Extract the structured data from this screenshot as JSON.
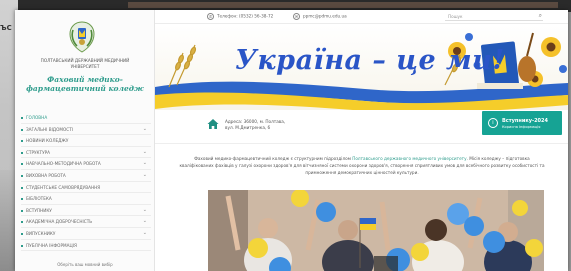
{
  "background": {
    "stray_text": "ЪС"
  },
  "sidebar": {
    "university_name": "Полтавський державний медичний університет",
    "college_name": "Фаховий медико-фармацевтичний коледж",
    "menu": [
      {
        "label": "Головна",
        "active": true,
        "has_submenu": false
      },
      {
        "label": "Загальні відомості",
        "active": false,
        "has_submenu": true
      },
      {
        "label": "Новини коледжу",
        "active": false,
        "has_submenu": false
      },
      {
        "label": "Структура",
        "active": false,
        "has_submenu": true
      },
      {
        "label": "Навчально-методична робота",
        "active": false,
        "has_submenu": true
      },
      {
        "label": "Виховна робота",
        "active": false,
        "has_submenu": true
      },
      {
        "label": "Студентське самоврядування",
        "active": false,
        "has_submenu": false
      },
      {
        "label": "Бібліотека",
        "active": false,
        "has_submenu": false
      },
      {
        "label": "Вступнику",
        "active": false,
        "has_submenu": true
      },
      {
        "label": "Академічна доброчесність",
        "active": false,
        "has_submenu": true
      },
      {
        "label": "Випускнику",
        "active": false,
        "has_submenu": true
      },
      {
        "label": "Публічна інформація",
        "active": false,
        "has_submenu": false
      }
    ],
    "footer": "Оберіть ваш мовний вибір"
  },
  "topbar": {
    "phone": "Телефон: (0532) 56-38-72",
    "email": "ppmc@pdmu.edu.ua",
    "search_placeholder": "Пошук"
  },
  "banner": {
    "title": "Україна – це ми!"
  },
  "address": {
    "line1": "Адреса: 36000, м. Полтава,",
    "line2": "вул. М.Дмитренка, 6"
  },
  "cta": {
    "title": "Вступнику-2024",
    "subtitle": "Корисна інформація"
  },
  "intro": {
    "text1": "Фаховий медико-фармацевтичний коледж є структурним підрозділом ",
    "link": "Полтавського державного медичного університету",
    "text2": ". Місія коледжу – підготовка кваліфікованих фахівців у галузі охорони здоров'я для вітчизняної системи охорони здоров'я, створення",
    "text3": "сприятливих умов для всебічного розвитку особистості та примноження демократичних цінностей культури."
  },
  "colors": {
    "accent": "#2e9c8c",
    "cta": "#16a394",
    "banner_title": "#2a55c7",
    "flag_blue": "#2f66c9",
    "flag_yellow": "#f5cd2a"
  }
}
